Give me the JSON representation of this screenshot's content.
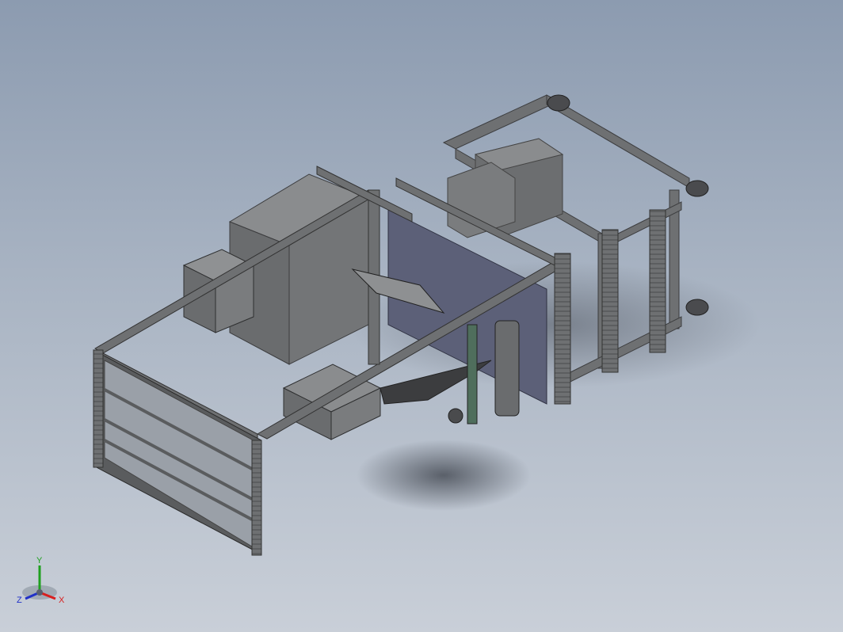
{
  "viewport": {
    "background_top": "#8c9bb0",
    "background_bottom": "#c9cfd8"
  },
  "model": {
    "frame_color": "#6e7072",
    "frame_dark": "#3c3d3f",
    "panel_color": "#7d7f81",
    "plate_color": "#5c6078",
    "glass_color": "#9aa0a8"
  },
  "triad": {
    "x_label": "X",
    "y_label": "Y",
    "z_label": "Z",
    "x_color": "#d81e1e",
    "y_color": "#1fa01f",
    "z_color": "#2030c8"
  }
}
